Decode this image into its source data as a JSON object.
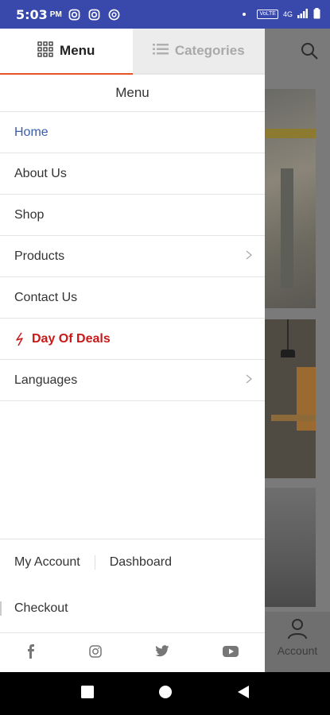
{
  "status_bar": {
    "time": "5:03",
    "ampm": "PM",
    "network_label": "VoLTE",
    "signal_label": "4G"
  },
  "drawer": {
    "tabs": [
      {
        "label": "Menu",
        "icon": "grid-icon",
        "active": true
      },
      {
        "label": "Categories",
        "icon": "list-icon",
        "active": false
      }
    ],
    "title": "Menu",
    "items": [
      {
        "label": "Home"
      },
      {
        "label": "About Us"
      },
      {
        "label": "Shop"
      },
      {
        "label": "Products"
      },
      {
        "label": "Contact Us"
      },
      {
        "label": "Day Of Deals"
      },
      {
        "label": "Languages"
      }
    ],
    "footer": {
      "my_account": "My Account",
      "dashboard": "Dashboard",
      "checkout": "Checkout"
    },
    "social": [
      "facebook-icon",
      "instagram-icon",
      "twitter-icon",
      "youtube-icon"
    ]
  },
  "background_page": {
    "account_label": "Account"
  },
  "colors": {
    "status_bar": "#3949ab",
    "active_tab_underline": "#e8542a",
    "active_item": "#3a5ea8",
    "deals": "#c81818"
  }
}
